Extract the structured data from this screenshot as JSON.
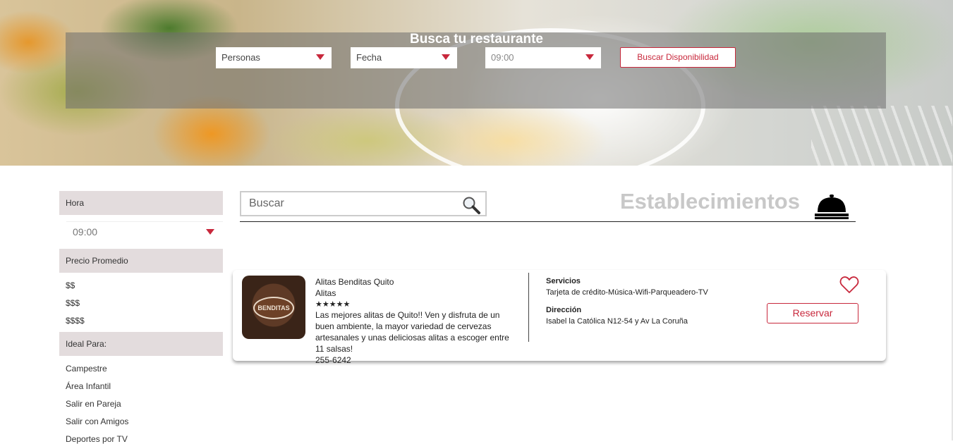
{
  "hero": {
    "title": "Busca tu restaurante",
    "personas_label": "Personas",
    "fecha_label": "Fecha",
    "hora_value": "09:00",
    "search_button": "Buscar Disponibilidad"
  },
  "sidebar": {
    "hora_header": "Hora",
    "hora_value": "09:00",
    "precio_header": "Precio Promedio",
    "precio_items": [
      "$$",
      "$$$",
      "$$$$"
    ],
    "ideal_header": "Ideal Para:",
    "ideal_items": [
      "Campestre",
      "Área Infantil",
      "Salir en Pareja",
      "Salir con Amigos",
      "Deportes por TV"
    ]
  },
  "search": {
    "placeholder": "Buscar"
  },
  "section": {
    "title": "Establecimientos"
  },
  "listing": {
    "name": "Alitas Benditas Quito",
    "category": "Alitas",
    "stars": "★★★★★",
    "description": "Las mejores alitas de Quito!! Ven y disfruta de un buen ambiente, la mayor variedad de cervezas artesanales y unas deliciosas alitas a escoger entre 11 salsas!",
    "phone": "255-6242",
    "logo_text": "BENDITAS",
    "services_label": "Servicios",
    "services_value": "Tarjeta de crédito-Música-Wifi-Parqueadero-TV",
    "address_label": "Dirección",
    "address_value": "Isabel la Católica N12-54 y Av La Coruña",
    "reserve_button": "Reservar"
  },
  "colors": {
    "accent": "#c8283c",
    "sidebar_header": "#e3dcdd",
    "title_gray": "#c8c8c8"
  }
}
